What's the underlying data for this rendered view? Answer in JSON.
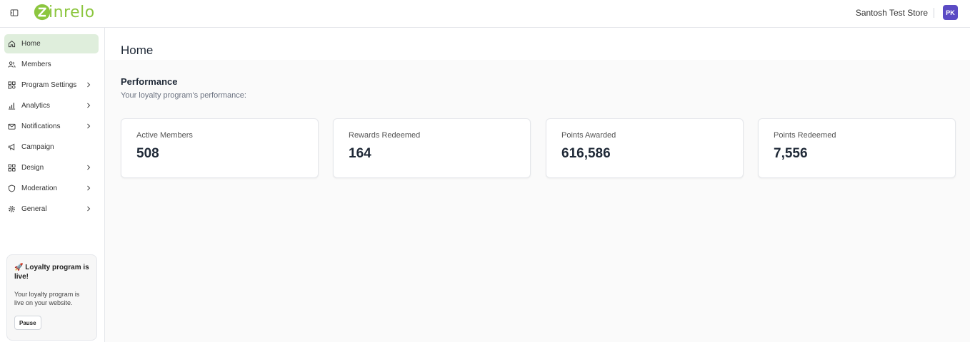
{
  "header": {
    "logo_text": "inrelo",
    "store_name": "Santosh Test Store",
    "avatar_initials": "PK"
  },
  "sidebar": {
    "items": [
      {
        "label": "Home",
        "icon": "home-icon",
        "active": true,
        "has_submenu": false
      },
      {
        "label": "Members",
        "icon": "users-icon",
        "active": false,
        "has_submenu": false
      },
      {
        "label": "Program Settings",
        "icon": "grid-settings-icon",
        "active": false,
        "has_submenu": true
      },
      {
        "label": "Analytics",
        "icon": "bar-chart-icon",
        "active": false,
        "has_submenu": true
      },
      {
        "label": "Notifications",
        "icon": "mail-icon",
        "active": false,
        "has_submenu": true
      },
      {
        "label": "Campaign",
        "icon": "megaphone-icon",
        "active": false,
        "has_submenu": false
      },
      {
        "label": "Design",
        "icon": "layout-icon",
        "active": false,
        "has_submenu": true
      },
      {
        "label": "Moderation",
        "icon": "shield-icon",
        "active": false,
        "has_submenu": true
      },
      {
        "label": "General",
        "icon": "gear-icon",
        "active": false,
        "has_submenu": true
      }
    ],
    "live_card": {
      "title": "🚀 Loyalty program is live!",
      "description": "Your loyalty program is live on your website.",
      "button_label": "Pause"
    }
  },
  "main": {
    "title": "Home",
    "section_title": "Performance",
    "section_subtitle": "Your loyalty program's performance:",
    "stats": [
      {
        "label": "Active Members",
        "value": "508"
      },
      {
        "label": "Rewards Redeemed",
        "value": "164"
      },
      {
        "label": "Points Awarded",
        "value": "616,586"
      },
      {
        "label": "Points Redeemed",
        "value": "7,556"
      }
    ]
  },
  "colors": {
    "brand_green": "#8cc63f",
    "active_nav_bg": "#dfeedc",
    "avatar_bg": "#5b4bc4"
  }
}
